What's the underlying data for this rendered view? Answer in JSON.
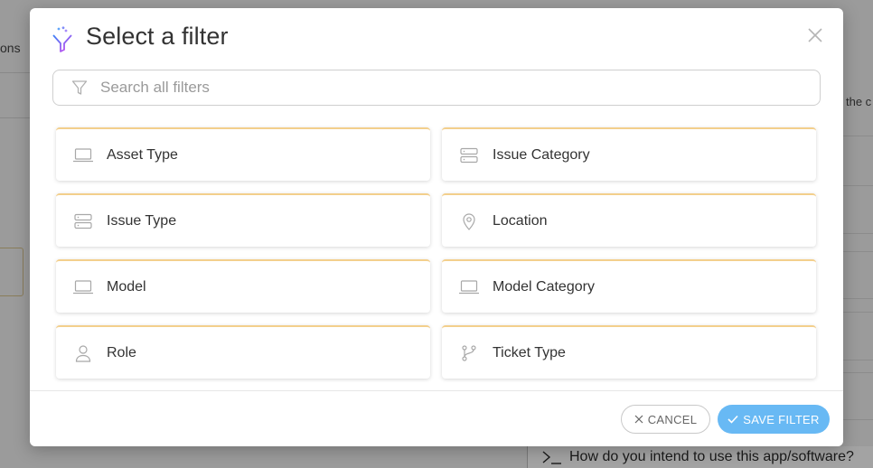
{
  "background": {
    "left_fragment": "ons",
    "right_fragment": "the c",
    "prompt_text": "How do you intend to use this app/software?"
  },
  "modal": {
    "title": "Select a filter",
    "search": {
      "placeholder": "Search all filters",
      "value": ""
    },
    "filters": [
      {
        "label": "Asset Type",
        "icon": "laptop-icon"
      },
      {
        "label": "Issue Category",
        "icon": "server-icon"
      },
      {
        "label": "Issue Type",
        "icon": "server-icon"
      },
      {
        "label": "Location",
        "icon": "map-pin-icon"
      },
      {
        "label": "Model",
        "icon": "laptop-icon"
      },
      {
        "label": "Model Category",
        "icon": "laptop-icon"
      },
      {
        "label": "Role",
        "icon": "user-icon"
      },
      {
        "label": "Ticket Type",
        "icon": "git-branch-icon"
      }
    ],
    "footer": {
      "cancel_label": "CANCEL",
      "save_label": "SAVE FILTER"
    }
  },
  "colors": {
    "card_accent": "#f3cf8c",
    "save_button": "#68b9f4",
    "icon_gradient_start": "#3b82f6",
    "icon_gradient_end": "#d946ef"
  }
}
